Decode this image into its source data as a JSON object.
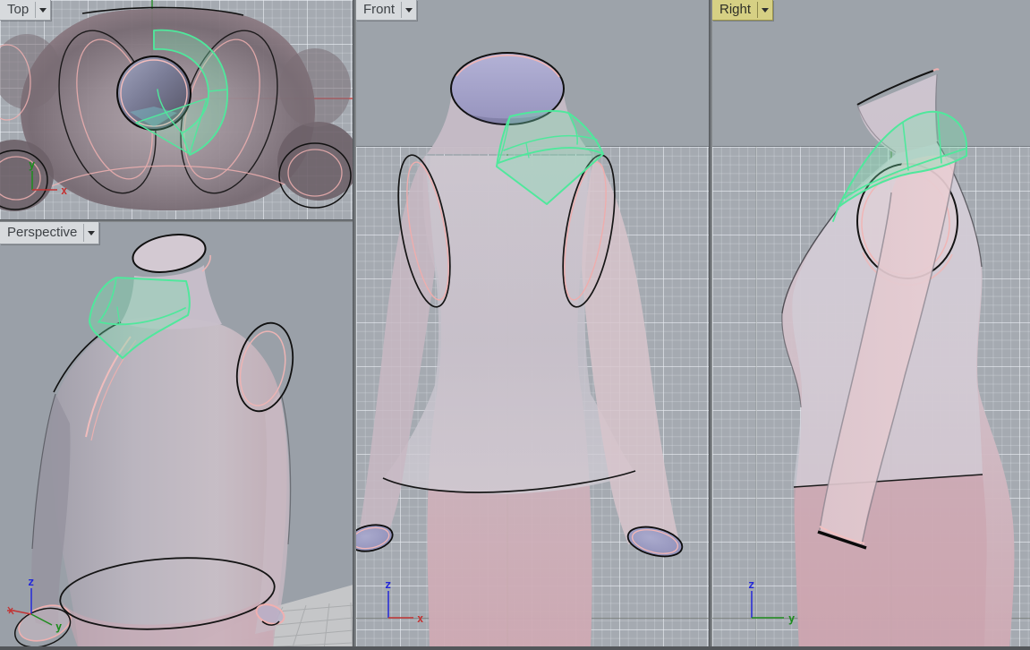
{
  "app": {
    "description": "four-viewport 3D modeling layout with mannequin, garment and selected collar surface"
  },
  "viewports": [
    {
      "id": "top",
      "label": "Top",
      "active": false,
      "axes": {
        "v": "y",
        "h": "x"
      }
    },
    {
      "id": "front",
      "label": "Front",
      "active": false,
      "axes": {
        "v": "z",
        "h": "x"
      }
    },
    {
      "id": "right",
      "label": "Right",
      "active": true,
      "axes": {
        "v": "z",
        "h": "y"
      }
    },
    {
      "id": "perspective",
      "label": "Perspective",
      "active": false,
      "axes": {
        "v": "z",
        "h": "y",
        "d": "x"
      }
    }
  ],
  "colors": {
    "active_tab_bg": "#d6d084",
    "tab_bg": "#d7dadd",
    "grid_bg": "#a5aab1",
    "plain_bg": "#9aa0a8",
    "selection_green": "#4fe89c",
    "axis_x_red": "#c23434",
    "axis_y_green": "#1e8c1e",
    "axis_z_blue": "#2428d8",
    "mannequin_pink": "#cfaab4",
    "garment_gray": "#cdc9d2",
    "cuff_lavender": "#9b9cc4",
    "outline_black": "#141414",
    "seam_pink": "#f0b4b4"
  }
}
